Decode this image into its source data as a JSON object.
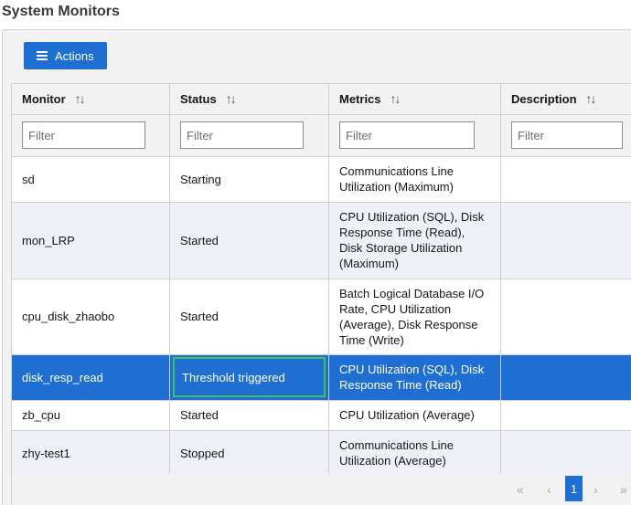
{
  "page": {
    "title": "System Monitors"
  },
  "toolbar": {
    "actions_label": "Actions",
    "actions_icon": "menu-icon"
  },
  "table": {
    "columns": [
      {
        "label": "Monitor",
        "sort_icon": "↑↓"
      },
      {
        "label": "Status",
        "sort_icon": "↑↓"
      },
      {
        "label": "Metrics",
        "sort_icon": "↑↓"
      },
      {
        "label": "Description",
        "sort_icon": "↑↓"
      }
    ],
    "filter_placeholder": "Filter",
    "rows": [
      {
        "monitor": "sd",
        "status": "Starting",
        "metrics": "Communications Line Utilization (Maximum)",
        "description": ""
      },
      {
        "monitor": "mon_LRP",
        "status": "Started",
        "metrics": "CPU Utilization (SQL), Disk Response Time (Read), Disk Storage Utilization (Maximum)",
        "description": ""
      },
      {
        "monitor": "cpu_disk_zhaobo",
        "status": "Started",
        "metrics": "Batch Logical Database I/O Rate, CPU Utilization (Average), Disk Response Time (Write)",
        "description": ""
      },
      {
        "monitor": "disk_resp_read",
        "status": "Threshold triggered",
        "metrics": "CPU Utilization (SQL), Disk Response Time (Read)",
        "description": "",
        "selected": true
      },
      {
        "monitor": "zb_cpu",
        "status": "Started",
        "metrics": "CPU Utilization (Average)",
        "description": ""
      },
      {
        "monitor": "zhy-test1",
        "status": "Stopped",
        "metrics": "Communications Line Utilization (Average)",
        "description": ""
      }
    ]
  },
  "pagination": {
    "first": "«",
    "prev": "‹",
    "current_page": "1",
    "next": "›",
    "last": "»"
  },
  "colors": {
    "accent": "#1f6fd2",
    "focus_outline": "#42be65",
    "row_alt": "#eef2f8"
  }
}
